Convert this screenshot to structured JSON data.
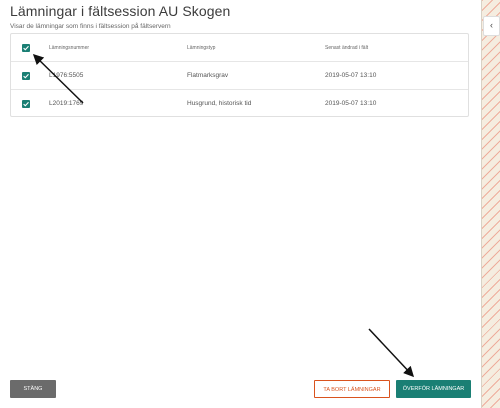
{
  "dialog": {
    "title": "Lämningar i fältsession AU Skogen",
    "subtitle": "Visar de lämningar som finns i fältsession på fältservern"
  },
  "table": {
    "headers": {
      "number": "Lämningsnummer",
      "type": "Lämningstyp",
      "modified": "Senast ändrad i fält"
    },
    "rows": [
      {
        "number": "L1976:5505",
        "type": "Flatmarksgrav",
        "modified": "2019-05-07  13:10",
        "checked": true
      },
      {
        "number": "L2019:1769",
        "type": "Husgrund, historisk tid",
        "modified": "2019-05-07  13:10",
        "checked": true
      }
    ],
    "select_all_checked": true
  },
  "buttons": {
    "close": "STÄNG",
    "remove": "TA BORT LÄMNINGAR",
    "transfer": "ÖVERFÖR LÄMNINGAR"
  },
  "side": {
    "tab_glyph": "‹"
  },
  "colors": {
    "accent": "#1a7f74",
    "danger": "#d9531e",
    "neutral_button": "#6b6b6b"
  }
}
